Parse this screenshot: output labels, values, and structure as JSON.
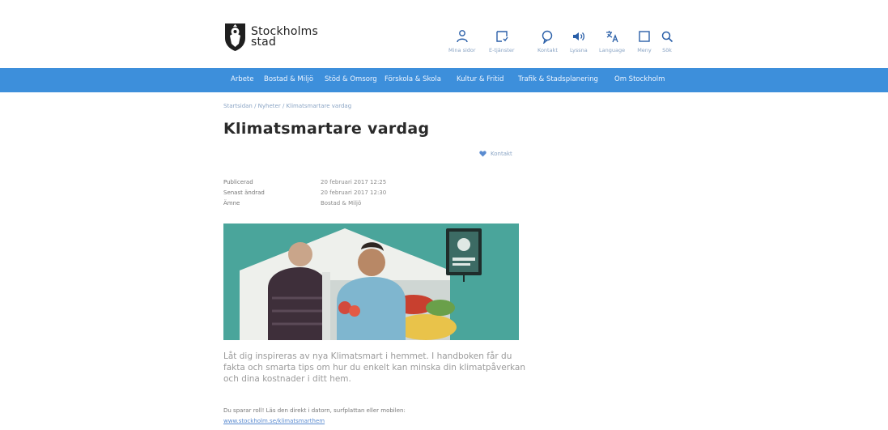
{
  "header": {
    "logo_line1": "Stockholms",
    "logo_line2": "stad",
    "tools": [
      {
        "icon": "person-icon",
        "label": "Mina sidor"
      },
      {
        "icon": "e-services-icon",
        "label": "E-tjänster"
      },
      {
        "icon": "chat-icon",
        "label": "Kontakt"
      },
      {
        "icon": "speaker-icon",
        "label": "Lyssna"
      },
      {
        "icon": "language-icon",
        "label": "Language"
      },
      {
        "icon": "menu-icon",
        "label": "Meny"
      },
      {
        "icon": "search-icon",
        "label": "Sök"
      }
    ]
  },
  "nav": {
    "items": [
      "Arbete",
      "Bostad & Miljö",
      "Stöd & Omsorg",
      "Förskola & Skola",
      "Kultur & Fritid",
      "Trafik & Stadsplanering",
      "Om Stockholm"
    ]
  },
  "breadcrumb": "Startsidan / Nyheter / Klimatsmartare vardag",
  "page_title": "Klimatsmartare vardag",
  "share_label": "Kontakt",
  "meta": [
    {
      "key": "Publicerad",
      "value": "20 februari 2017 12:25"
    },
    {
      "key": "Senast ändrad",
      "value": "20 februari 2017 12:30"
    },
    {
      "key": "Ämne",
      "value": "Bostad & Miljö"
    }
  ],
  "intro": "Låt dig inspireras av nya Klimatsmart i hemmet. I handboken får du fakta och smarta tips om hur du enkelt kan minska din klimatpåverkan och dina kostnader i ditt hem.",
  "note": "Du sparar roll! Läs den direkt i datorn, surfplattan eller mobilen:",
  "link": "www.stockholm.se/klimatsmarthem",
  "colors": {
    "nav_bar": "#3d8fdb",
    "hero_teal": "#4aa59b",
    "link": "#5a8bd0"
  }
}
